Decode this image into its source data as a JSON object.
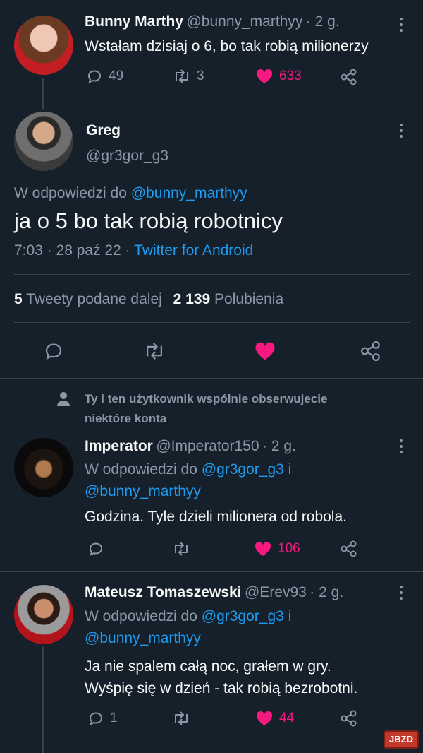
{
  "tweet1": {
    "name": "Bunny Marthy",
    "handle": "@bunny_marthyy",
    "time": "· 2 g.",
    "text": "Wstałam dzisiaj o 6, bo tak robią milionerzy",
    "replies": "49",
    "retweets": "3",
    "likes": "633"
  },
  "main": {
    "name": "Greg",
    "handle": "@gr3gor_g3",
    "reply_prefix": "W odpowiedzi do",
    "reply_to": "@bunny_marthyy",
    "text": "ja o 5 bo tak robią robotnicy",
    "date": "7:03 · 28 paź 22 ·",
    "source": "Twitter for Android",
    "retweet_count": "5",
    "retweet_label": "Tweety podane dalej",
    "like_count": "2 139",
    "like_label": "Polubienia"
  },
  "social_context": {
    "line1": "Ty i ten użytkownik wspólnie obserwujecie",
    "line2": "niektóre konta"
  },
  "reply1": {
    "name": "Imperator",
    "handle": "@Imperator150",
    "time": "· 2 g.",
    "reply_prefix": "W odpowiedzi do",
    "reply_to1": "@gr3gor_g3",
    "reply_and": "i",
    "reply_to2": "@bunny_marthyy",
    "text": "Godzina. Tyle dzieli milionera od robola.",
    "likes": "106"
  },
  "reply2": {
    "name": "Mateusz Tomaszewski",
    "handle": "@Erev93",
    "time": "· 2 g.",
    "reply_prefix": "W odpowiedzi do",
    "reply_to1": "@gr3gor_g3",
    "reply_and": "i",
    "reply_to2": "@bunny_marthyy",
    "text_line1": "Ja nie spalem całą noc, grałem w gry.",
    "text_line2": "Wyśpię się w dzień - tak robią bezrobotni.",
    "replies": "1",
    "likes": "44"
  },
  "watermark": "JBZD",
  "colors": {
    "background": "#15202b",
    "accent": "#1d9bf0",
    "like": "#f91880",
    "muted": "#8b98a5",
    "divider": "#38444d"
  }
}
